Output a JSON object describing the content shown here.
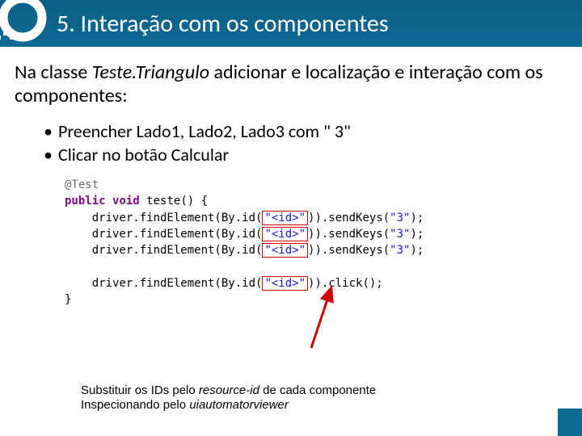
{
  "header": {
    "title": "5. Interação com os componentes"
  },
  "intro": {
    "pre": "Na classe ",
    "cls": "Teste.Triangulo",
    "post": " adicionar e localização e interação com os componentes:"
  },
  "bullets": [
    "Preencher Lado1, Lado2, Lado3 com \" 3\"",
    "Clicar no botão Calcular"
  ],
  "code": {
    "anno": "@Test",
    "pub": "public",
    "void": "void",
    "fn": "teste() {",
    "line_a": "driver.findElement(By.id(",
    "id_ph": "\"<id>\"",
    "send": ")).sendKeys(",
    "three": "\"3\"",
    "send_end": ");",
    "click": ")).click();",
    "rb": "}"
  },
  "note": {
    "l1a": "Substituir os IDs pelo ",
    "l1b": "resource-id",
    "l1c": " de cada componente",
    "l2a": "Inspecionando pelo ",
    "l2b": "uiautomatorviewer"
  }
}
